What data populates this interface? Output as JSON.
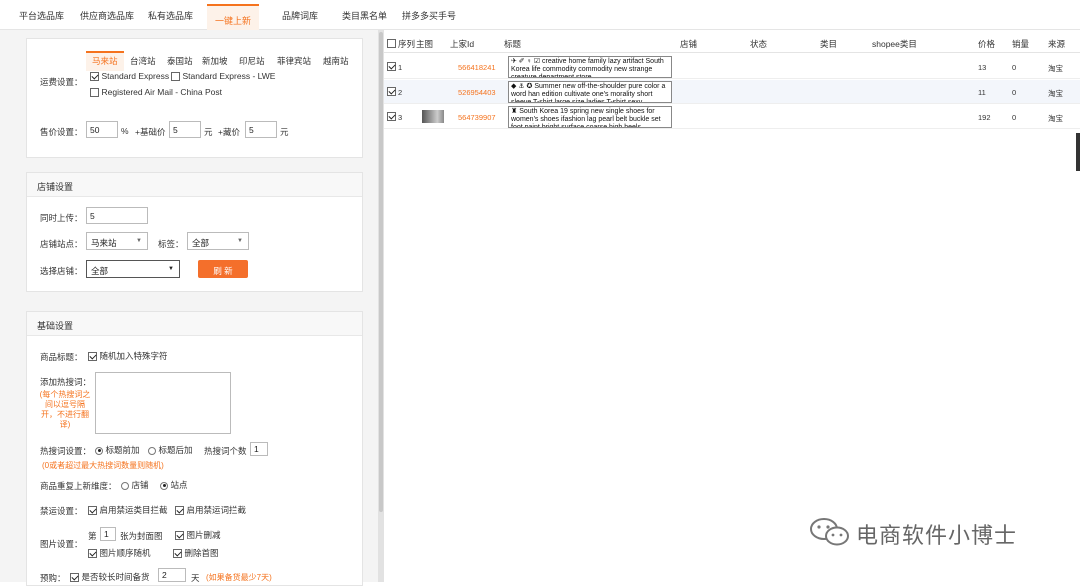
{
  "nav": {
    "tabs": [
      "平台选品库",
      "供应商选品库",
      "私有选品库",
      "一键上新",
      "品牌词库",
      "类目黑名单",
      "拼多多买手号"
    ],
    "active_index": 3
  },
  "shipping": {
    "sites": [
      "马来站",
      "台湾站",
      "泰国站",
      "新加坡",
      "印尼站",
      "菲律宾站",
      "越南站"
    ],
    "active_site": 0,
    "label": "运费设置：",
    "options": [
      {
        "label": "Standard Express",
        "checked": true
      },
      {
        "label": "Standard Express - LWE",
        "checked": false
      },
      {
        "label": "Registered Air Mail - China Post",
        "checked": false
      }
    ]
  },
  "price": {
    "label": "售价设置：",
    "percent_value": "50",
    "percent_unit": "%",
    "base_label": "+基础价",
    "base_value": "5",
    "base_unit": "元",
    "extra_label": "+藏价",
    "extra_value": "5",
    "extra_unit": "元"
  },
  "store": {
    "header": "店铺设置",
    "concurrent_label": "同时上传：",
    "concurrent_value": "5",
    "site_label": "店铺站点：",
    "site_value": "马来站",
    "tag_label": "标签：",
    "tag_value": "全部",
    "choose_label": "选择店铺：",
    "choose_value": "全部",
    "refresh_label": "刷 新"
  },
  "basic": {
    "header": "基础设置",
    "title_label": "商品标题：",
    "title_random_label": "随机加入特殊字符",
    "hotword_label": "添加热搜词：",
    "hotword_hint": "(每个热搜词之间以逗号隔开，不进行翻译)",
    "hotword_setting_label": "热搜词设置：",
    "hotword_front": "标题前加",
    "hotword_back": "标题后加",
    "hotword_count_label": "热搜词个数",
    "hotword_count_value": "1",
    "hotword_count_hint": "(0或者超过最大热搜词数量则随机)",
    "repeat_label": "商品重复上新维度：",
    "repeat_store": "店铺",
    "repeat_site": "站点",
    "ban_label": "禁运设置：",
    "ban_category": "启用禁运类目拦截",
    "ban_word": "启用禁运词拦截",
    "image_label": "图片设置：",
    "image_nth_prefix": "第",
    "image_nth_value": "1",
    "image_nth_suffix": "张为封面图",
    "image_cut": "图片删减",
    "image_random": "图片顺序随机",
    "image_delete_first": "删除首图",
    "preorder_label": "预购：",
    "preorder_check": "是否较长时间备货",
    "preorder_days": "2",
    "preorder_unit": "天",
    "preorder_hint": "(如果备货最少7天)"
  },
  "table": {
    "headers": [
      "序列",
      "主图",
      "上家Id",
      "标题",
      "店铺",
      "状态",
      "类目",
      "shopee类目",
      "价格",
      "销量",
      "来源"
    ],
    "rows": [
      {
        "index": "1",
        "id": "566418241",
        "title": "✈ ✐ ♀ ☑ creative home family lazy artifact South Korea life commodity commodity new strange creature department store",
        "price": "13",
        "sales": "0",
        "source": "淘宝",
        "has_image": false
      },
      {
        "index": "2",
        "id": "526954403",
        "title": "◆ ⚓ ✪ Summer new off-the-shoulder pure color a word han edition cultivate one's morality short sleeve T-shirt large size ladies T-shirt sexy",
        "price": "11",
        "sales": "0",
        "source": "淘宝",
        "has_image": false
      },
      {
        "index": "3",
        "id": "564739907",
        "title": "♜ South Korea 19 spring new single shoes for women's shoes ifashion lag pearl belt buckle set foot paint bright surface coarse high heels",
        "price": "192",
        "sales": "0",
        "source": "淘宝",
        "has_image": true
      }
    ]
  },
  "watermark": {
    "text": "电商软件小博士",
    "icon": "wechat-icon"
  }
}
